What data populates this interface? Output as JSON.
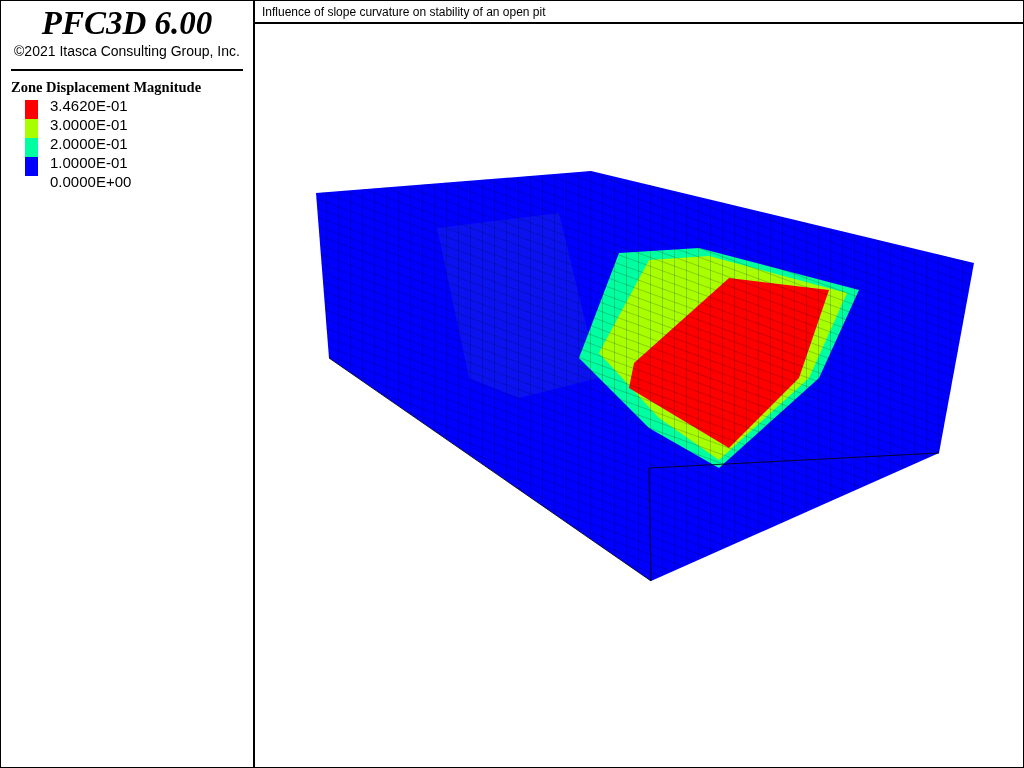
{
  "app_title": "PFC3D 6.00",
  "copyright": "©2021 Itasca Consulting Group, Inc.",
  "legend": {
    "title": "Zone Displacement Magnitude",
    "bands": [
      {
        "color": "#ff0000"
      },
      {
        "color": "#a8ff00"
      },
      {
        "color": "#00ffa0"
      },
      {
        "color": "#0000ff"
      }
    ],
    "labels": [
      "3.4620E-01",
      "3.0000E-01",
      "2.0000E-01",
      "1.0000E-01",
      "0.0000E+00"
    ]
  },
  "plot_title": "Influence of slope curvature on stability of an open pit"
}
